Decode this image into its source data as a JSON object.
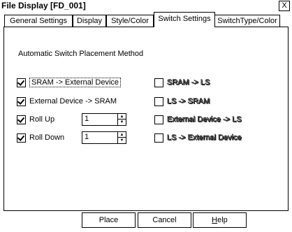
{
  "window": {
    "title": "File Display [FD_001]",
    "close_label": "X"
  },
  "tabs": [
    {
      "label": "General Settings"
    },
    {
      "label": "Display"
    },
    {
      "label": "Style/Color"
    },
    {
      "label": "Switch Settings"
    },
    {
      "label": "SwitchType/Color"
    }
  ],
  "active_tab": "Switch Settings",
  "panel": {
    "section_label": "Automatic Switch Placement Method"
  },
  "left_options": [
    {
      "label": "SRAM -> External Device",
      "checked": true
    },
    {
      "label": "External Device -> SRAM",
      "checked": true
    },
    {
      "label": "Roll Up",
      "checked": true,
      "spin_value": "1"
    },
    {
      "label": "Roll Down",
      "checked": true,
      "spin_value": "1"
    }
  ],
  "right_options": [
    {
      "label": "SRAM -> LS",
      "checked": false,
      "enabled": false
    },
    {
      "label": "LS -> SRAM",
      "checked": false,
      "enabled": false
    },
    {
      "label": "External Device -> LS",
      "checked": false,
      "enabled": false
    },
    {
      "label": "LS -> External Device",
      "checked": false,
      "enabled": false
    }
  ],
  "buttons": {
    "place": "Place",
    "cancel": "Cancel",
    "help_mnemonic": "H",
    "help_rest": "elp"
  }
}
